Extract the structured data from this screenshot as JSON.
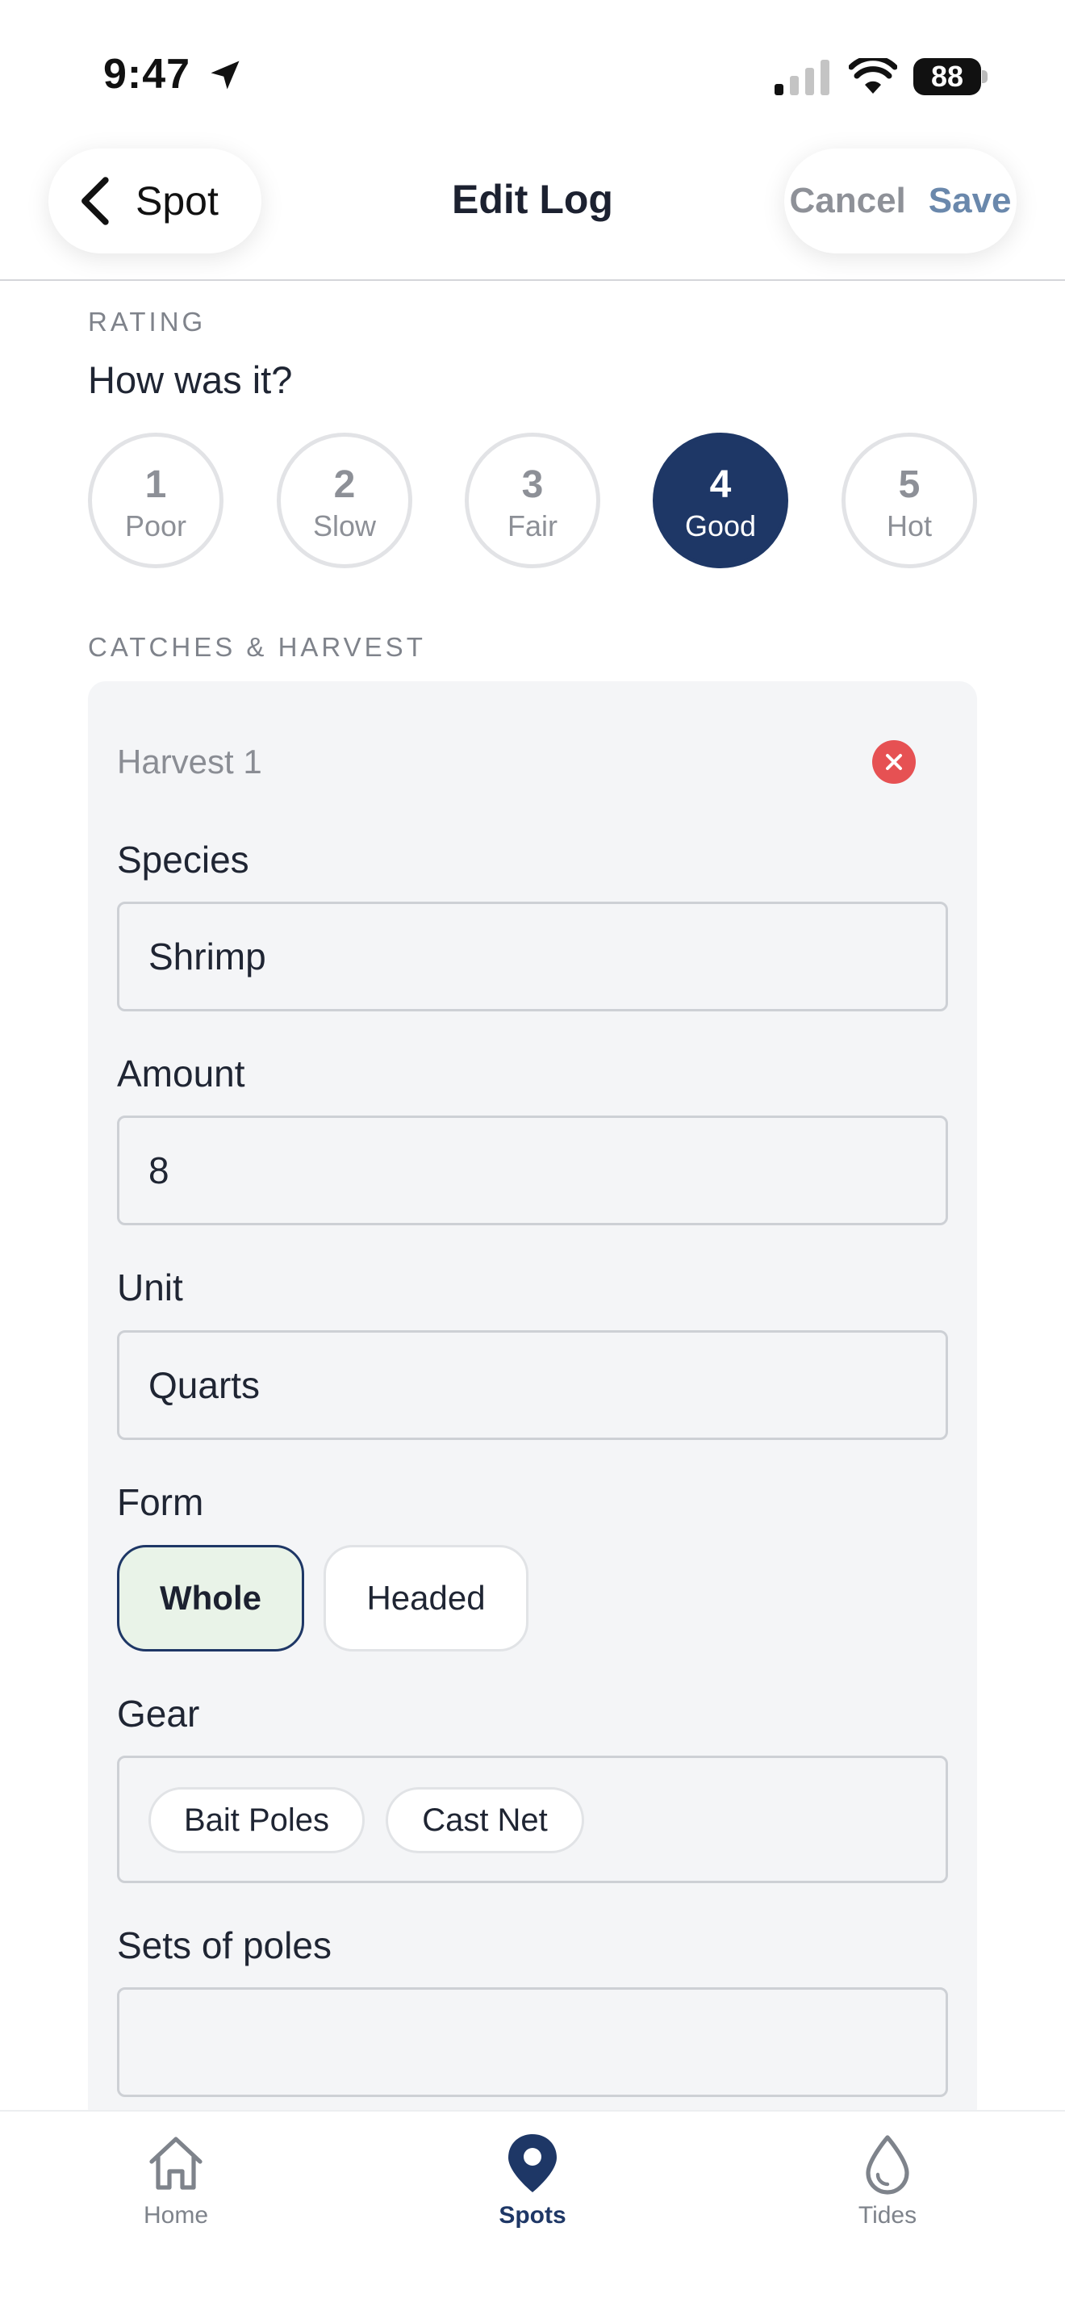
{
  "status_bar": {
    "time": "9:47",
    "battery": "88"
  },
  "nav": {
    "back_label": "Spot",
    "title": "Edit Log",
    "cancel_label": "Cancel",
    "save_label": "Save"
  },
  "rating": {
    "section_label": "RATING",
    "question": "How was it?",
    "options": [
      {
        "value": "1",
        "label": "Poor"
      },
      {
        "value": "2",
        "label": "Slow"
      },
      {
        "value": "3",
        "label": "Fair"
      },
      {
        "value": "4",
        "label": "Good"
      },
      {
        "value": "5",
        "label": "Hot"
      }
    ],
    "selected": "4"
  },
  "catches": {
    "section_label": "CATCHES & HARVEST",
    "card_title": "Harvest 1",
    "species_label": "Species",
    "species_value": "Shrimp",
    "amount_label": "Amount",
    "amount_value": "8",
    "unit_label": "Unit",
    "unit_value": "Quarts",
    "form_label": "Form",
    "form_options": [
      "Whole",
      "Headed"
    ],
    "form_selected": "Whole",
    "gear_label": "Gear",
    "gear_tags": [
      "Bait Poles",
      "Cast Net"
    ],
    "sets_label": "Sets of poles",
    "sets_value": ""
  },
  "tabbar": {
    "items": [
      "Home",
      "Spots",
      "Tides"
    ],
    "active": "Spots"
  },
  "colors": {
    "accent": "#1e3766",
    "remove": "#e65153",
    "selected_chip_bg": "#e9f3e8",
    "save": "#6a88ac"
  },
  "icons": [
    "location-arrow-icon",
    "signal-icon",
    "wifi-icon",
    "battery-icon",
    "chevron-left-icon",
    "close-icon",
    "home-icon",
    "map-pin-icon",
    "water-drop-icon"
  ]
}
